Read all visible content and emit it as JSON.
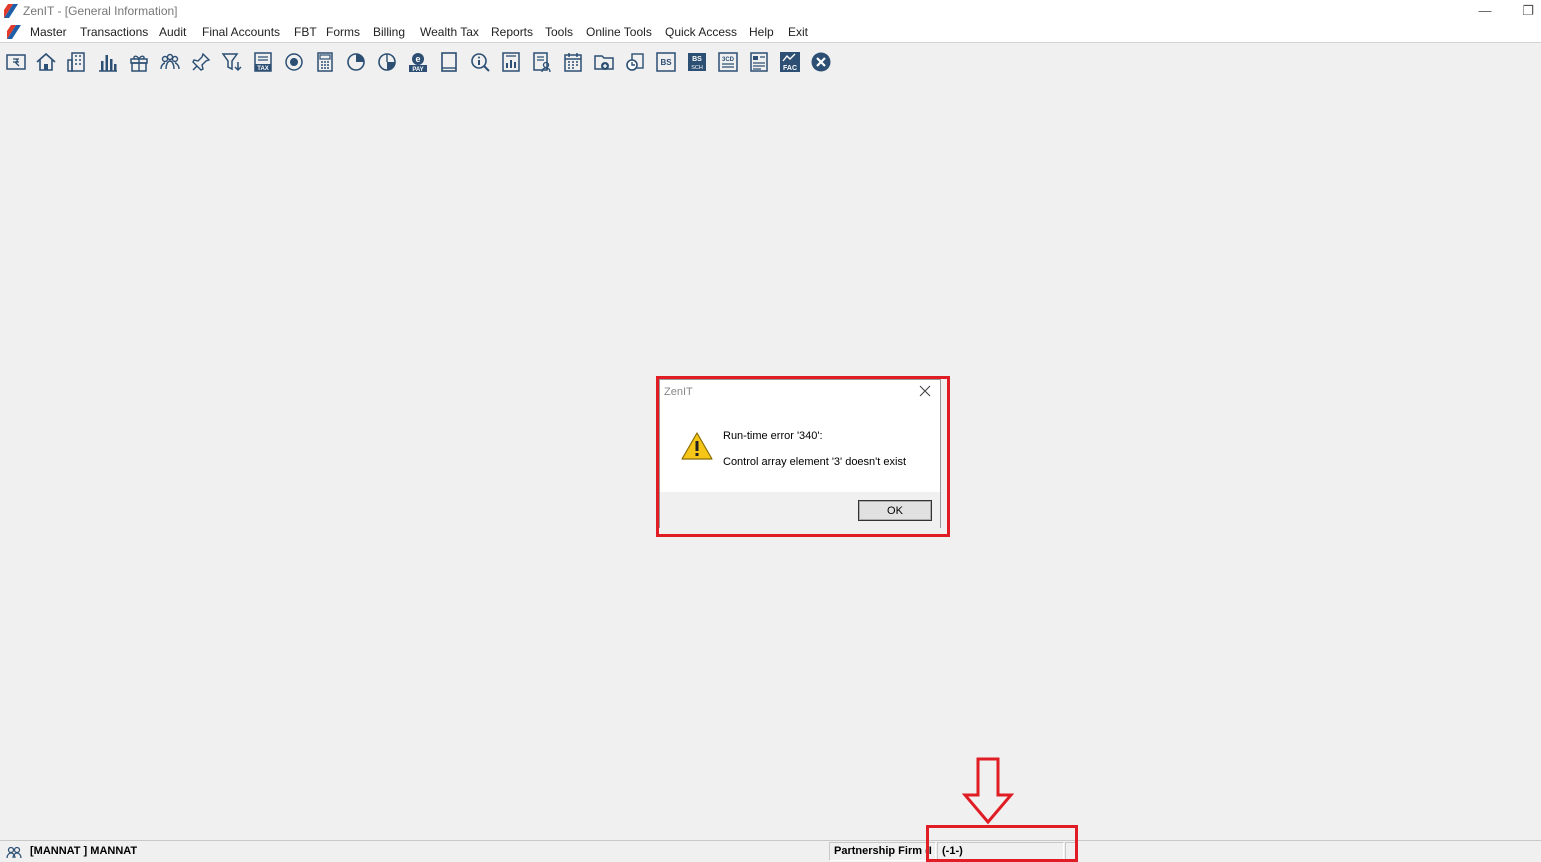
{
  "window": {
    "title": "ZenIT - [General Information]",
    "minimize_glyph": "—",
    "restore_glyph": "❐"
  },
  "menu": {
    "items": [
      "Master",
      "Transactions",
      "Audit",
      "Final Accounts",
      "FBT",
      "Forms",
      "Billing",
      "Wealth Tax",
      "Reports",
      "Tools",
      "Online Tools",
      "Quick Access",
      "Help",
      "Exit"
    ]
  },
  "toolbar": {
    "icons": [
      "rupee-card-icon",
      "home-icon",
      "building-icon",
      "bar-chart-icon",
      "gift-icon",
      "group-icon",
      "pin-icon",
      "filter-icon",
      "tax-icon",
      "target-icon",
      "calculator-icon",
      "pie-chart-icon",
      "pie-chart-alt-icon",
      "e-pay-icon",
      "book-icon",
      "info-search-icon",
      "report-icon",
      "user-doc-icon",
      "calendar-icon",
      "folder-add-icon",
      "refresh-icon",
      "bs-icon",
      "bs-sch-icon",
      "3cd-icon",
      "form-icon",
      "fac-icon",
      "close-circle-icon"
    ],
    "labels": {
      "tax": "TAX",
      "epay_e": "e",
      "epay_pay": "PAY",
      "bs": "BS",
      "bs_sch_top": "BS",
      "bs_sch_bottom": "SCH",
      "3cd": "3CD",
      "fac": "FAC"
    }
  },
  "dialog": {
    "title": "ZenIT",
    "line1": "Run-time error '340':",
    "line2": "Control array element '3' doesn't exist",
    "ok_label": "OK"
  },
  "statusbar": {
    "user": "[MANNAT ] MANNAT",
    "entity": "Partnership Firm (I",
    "code": "(-1-)"
  },
  "colors": {
    "highlight": "#e01d24",
    "icon_blue": "#2c4f73"
  }
}
